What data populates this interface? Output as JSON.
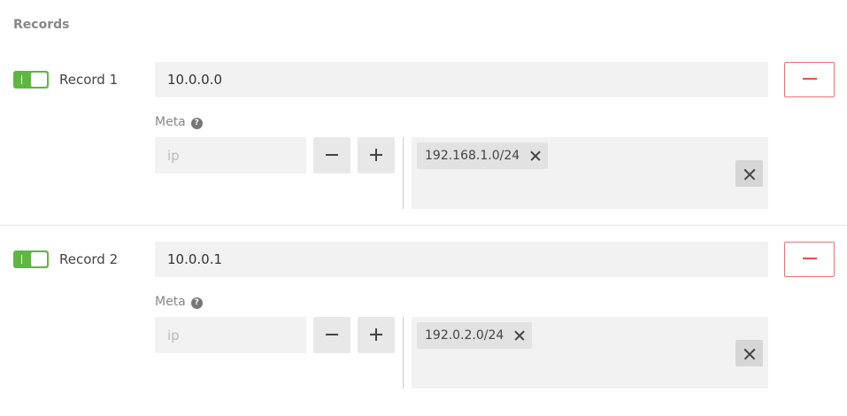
{
  "section": {
    "title": "Records"
  },
  "records": [
    {
      "label": "Record 1",
      "enabled": true,
      "value": "10.0.0.0",
      "meta_label": "Meta",
      "ip_placeholder": "ip",
      "tags": [
        "192.168.1.0/24"
      ]
    },
    {
      "label": "Record 2",
      "enabled": true,
      "value": "10.0.0.1",
      "meta_label": "Meta",
      "ip_placeholder": "ip",
      "tags": [
        "192.0.2.0/24"
      ]
    }
  ],
  "icons": {
    "help": "question-circle-icon",
    "remove": "minus-icon",
    "decrement": "minus-icon",
    "increment": "plus-icon",
    "tag_remove": "close-icon",
    "clear": "close-icon",
    "help_glyph": "?"
  },
  "colors": {
    "toggle_on": "#5fb643",
    "remove_border": "#e57373",
    "field_bg": "#f2f2f2"
  }
}
